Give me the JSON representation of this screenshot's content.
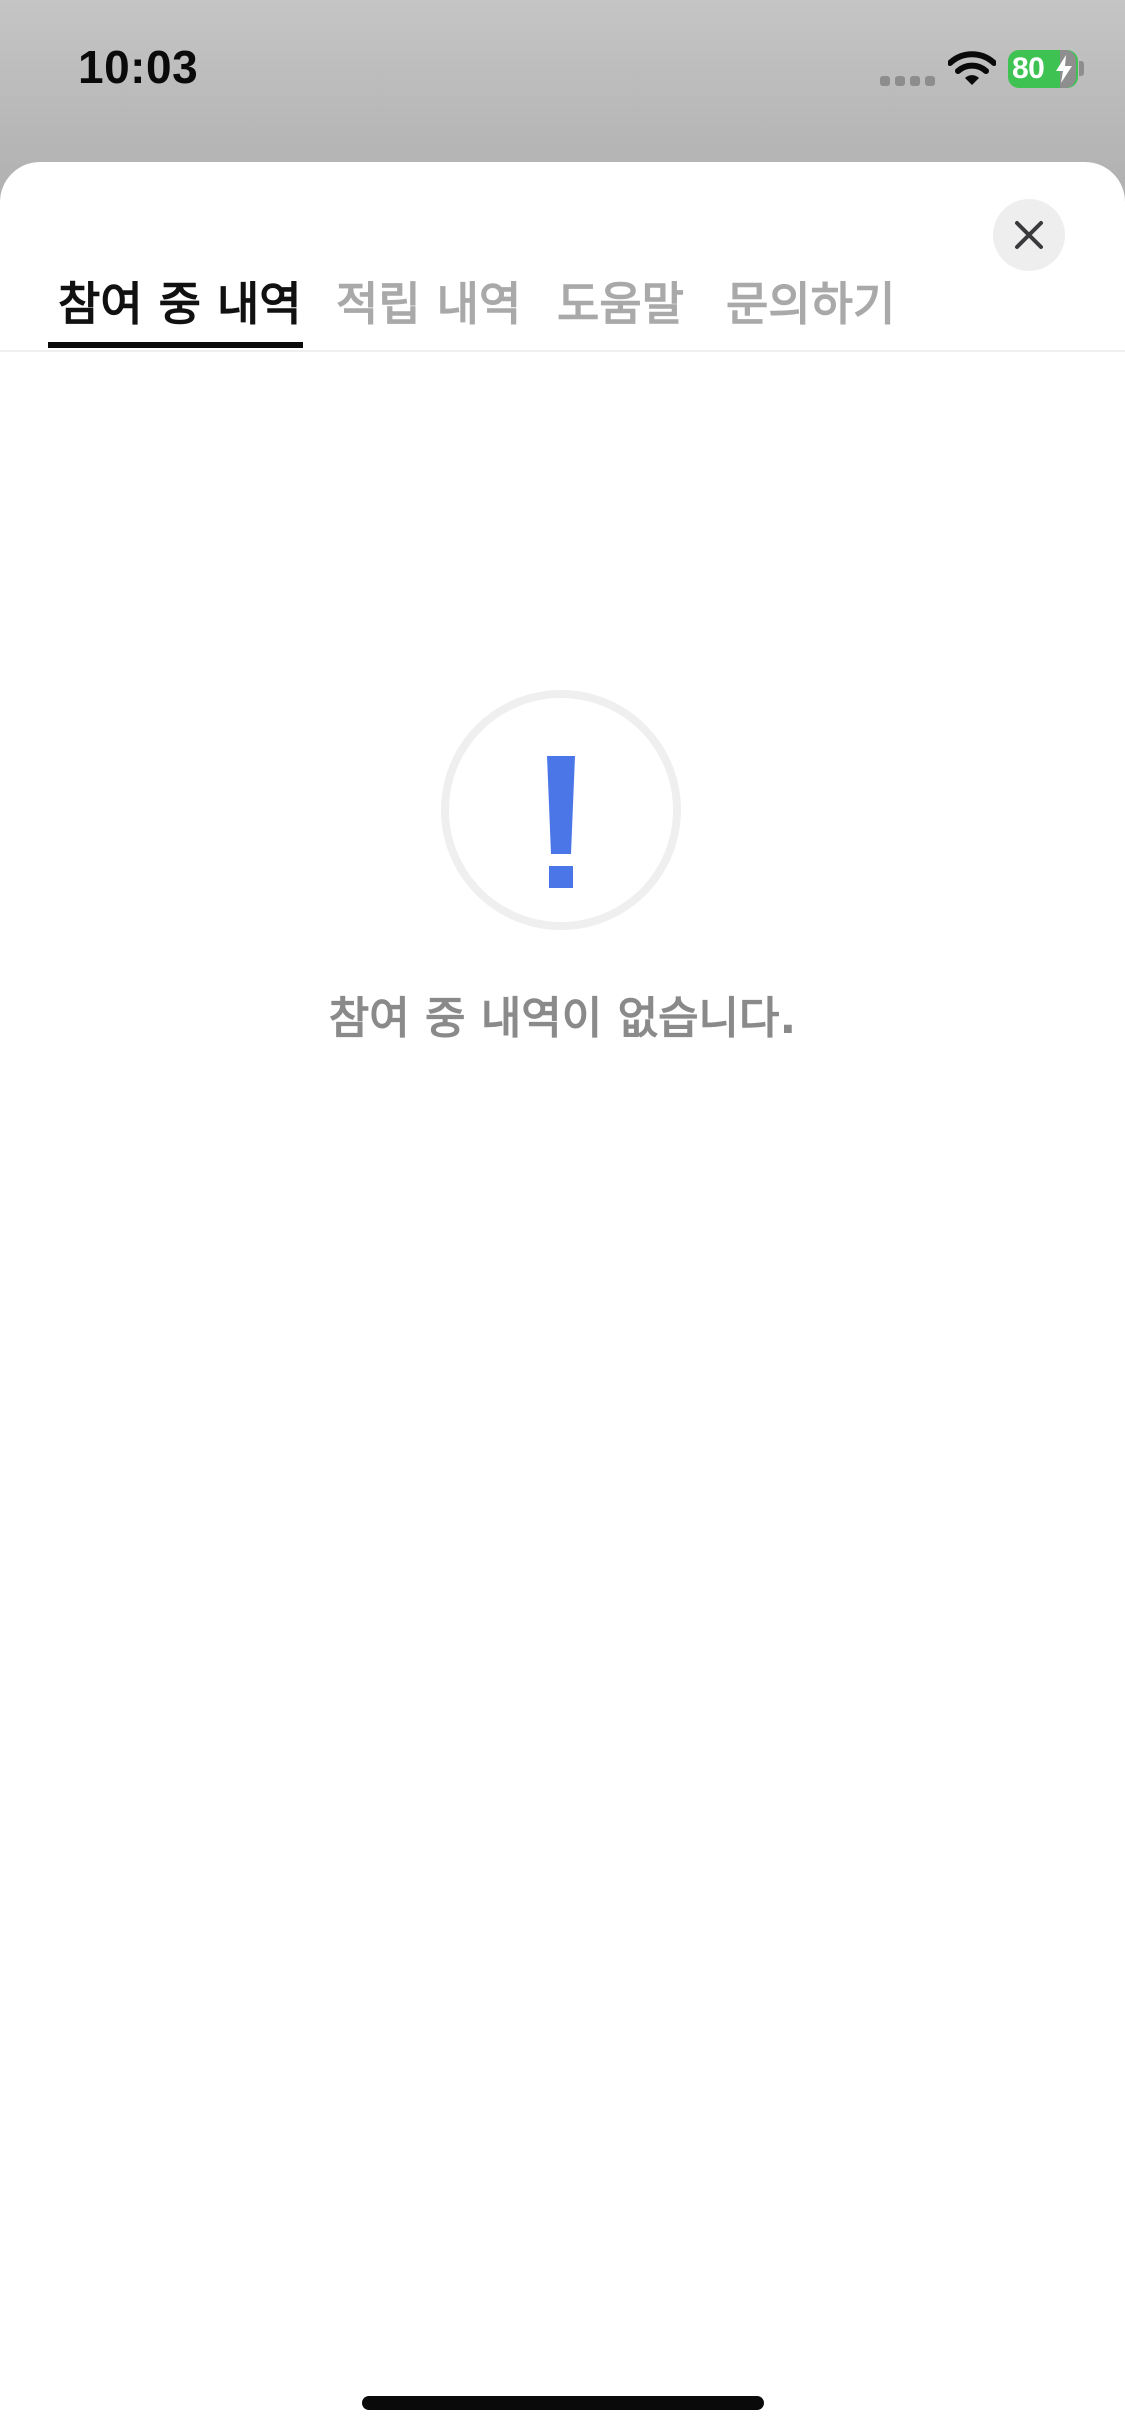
{
  "status_bar": {
    "time": "10:03",
    "battery_percent": "80",
    "signal_icon": "cellular-signal-icon",
    "wifi_icon": "wifi-icon",
    "charging_icon": "charging-bolt-icon"
  },
  "sheet": {
    "close_icon": "close-icon",
    "tabs": [
      {
        "label": "참여 중 내역",
        "active": true
      },
      {
        "label": "적립 내역",
        "active": false
      },
      {
        "label": "도움말",
        "active": false
      },
      {
        "label": "문의하기",
        "active": false
      }
    ],
    "empty_state": {
      "icon": "exclamation-icon",
      "message": "참여 중 내역이 없습니다."
    }
  },
  "colors": {
    "accent_blue": "#4a76e8",
    "battery_green": "#3ec353",
    "inactive_tab": "#a9a9a9",
    "message_gray": "#8a8a8a"
  }
}
